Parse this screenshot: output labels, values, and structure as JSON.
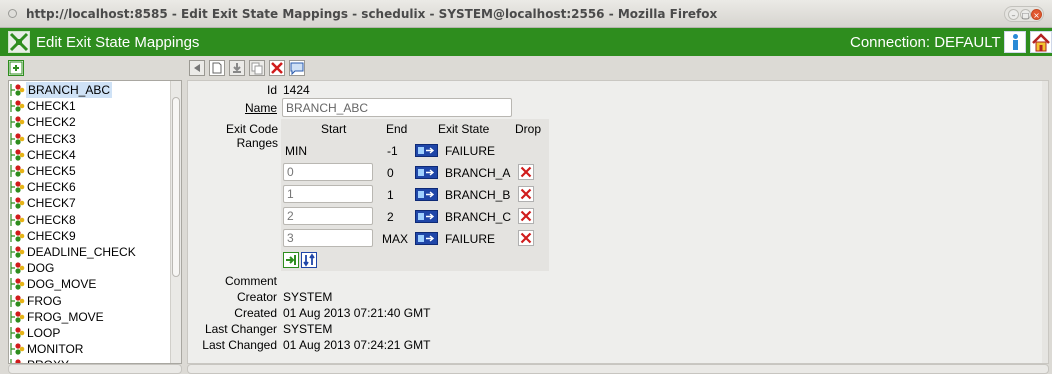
{
  "window": {
    "title": "http://localhost:8585 - Edit Exit State Mappings - schedulix - SYSTEM@localhost:2556 - Mozilla Firefox"
  },
  "app": {
    "title": "Edit Exit State Mappings",
    "connection": "Connection: DEFAULT"
  },
  "tree": {
    "items": [
      {
        "label": "BRANCH_ABC",
        "selected": true
      },
      {
        "label": "CHECK1"
      },
      {
        "label": "CHECK2"
      },
      {
        "label": "CHECK3"
      },
      {
        "label": "CHECK4"
      },
      {
        "label": "CHECK5"
      },
      {
        "label": "CHECK6"
      },
      {
        "label": "CHECK7"
      },
      {
        "label": "CHECK8"
      },
      {
        "label": "CHECK9"
      },
      {
        "label": "DEADLINE_CHECK"
      },
      {
        "label": "DOG"
      },
      {
        "label": "DOG_MOVE"
      },
      {
        "label": "FROG"
      },
      {
        "label": "FROG_MOVE"
      },
      {
        "label": "LOOP"
      },
      {
        "label": "MONITOR"
      },
      {
        "label": "PROXY"
      }
    ]
  },
  "detail": {
    "id_label": "Id",
    "id_value": "1424",
    "name_label": "Name",
    "name_value": "BRANCH_ABC",
    "ranges_label": "Exit Code Ranges",
    "headers": {
      "start": "Start",
      "end": "End",
      "exit_state": "Exit State",
      "drop": "Drop"
    },
    "ranges": [
      {
        "start": "MIN",
        "end": "-1",
        "state": "FAILURE",
        "editable": false
      },
      {
        "start": "0",
        "end": "0",
        "state": "BRANCH_A",
        "editable": true
      },
      {
        "start": "1",
        "end": "1",
        "state": "BRANCH_B",
        "editable": true
      },
      {
        "start": "2",
        "end": "2",
        "state": "BRANCH_C",
        "editable": true
      },
      {
        "start": "3",
        "end": "MAX",
        "state": "FAILURE",
        "editable": true
      }
    ],
    "comment_label": "Comment",
    "creator_label": "Creator",
    "creator_value": "SYSTEM",
    "created_label": "Created",
    "created_value": "01 Aug 2013 07:21:40 GMT",
    "last_changer_label": "Last Changer",
    "last_changer_value": "SYSTEM",
    "last_changed_label": "Last Changed",
    "last_changed_value": "01 Aug 2013 07:24:21 GMT"
  },
  "icons": {
    "tree_job": "job-state-icon",
    "exit_state": "exit-state-mapping-icon",
    "drop": "delete-x-icon"
  },
  "colors": {
    "appbar": "#2e8d1e",
    "drop_red": "#d01c1c",
    "exit_state_blue": "#1f46a8"
  }
}
